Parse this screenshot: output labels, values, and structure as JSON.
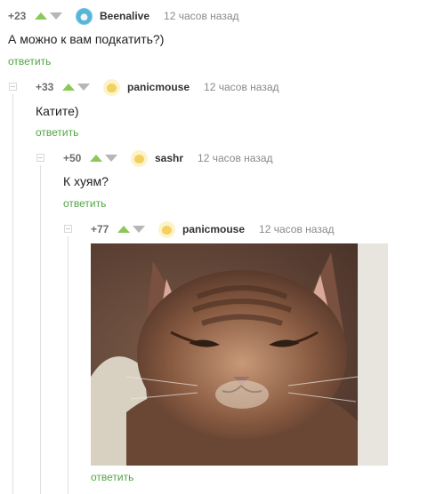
{
  "comments": [
    {
      "rating": "+23",
      "username": "Beenalive",
      "time": "12 часов назад",
      "text": "А можно к вам подкатить?)",
      "reply": "ответить",
      "avatar_icon": "beenalive-avatar-icon"
    },
    {
      "rating": "+33",
      "username": "panicmouse",
      "time": "12 часов назад",
      "text": "Катите)",
      "reply": "ответить",
      "avatar_icon": "panicmouse-avatar-icon"
    },
    {
      "rating": "+50",
      "username": "sashr",
      "time": "12 часов назад",
      "text": "К хуям?",
      "reply": "ответить",
      "avatar_icon": "sashr-avatar-icon"
    },
    {
      "rating": "+77",
      "username": "panicmouse",
      "time": "12 часов назад",
      "image": "cat-photo",
      "reply": "ответить",
      "avatar_icon": "panicmouse-avatar-icon"
    }
  ],
  "colors": {
    "vote_up": "#8ac858",
    "vote_down": "#b6b6b6",
    "reply_link": "#53a545",
    "meta_text": "#8a8a8a"
  }
}
